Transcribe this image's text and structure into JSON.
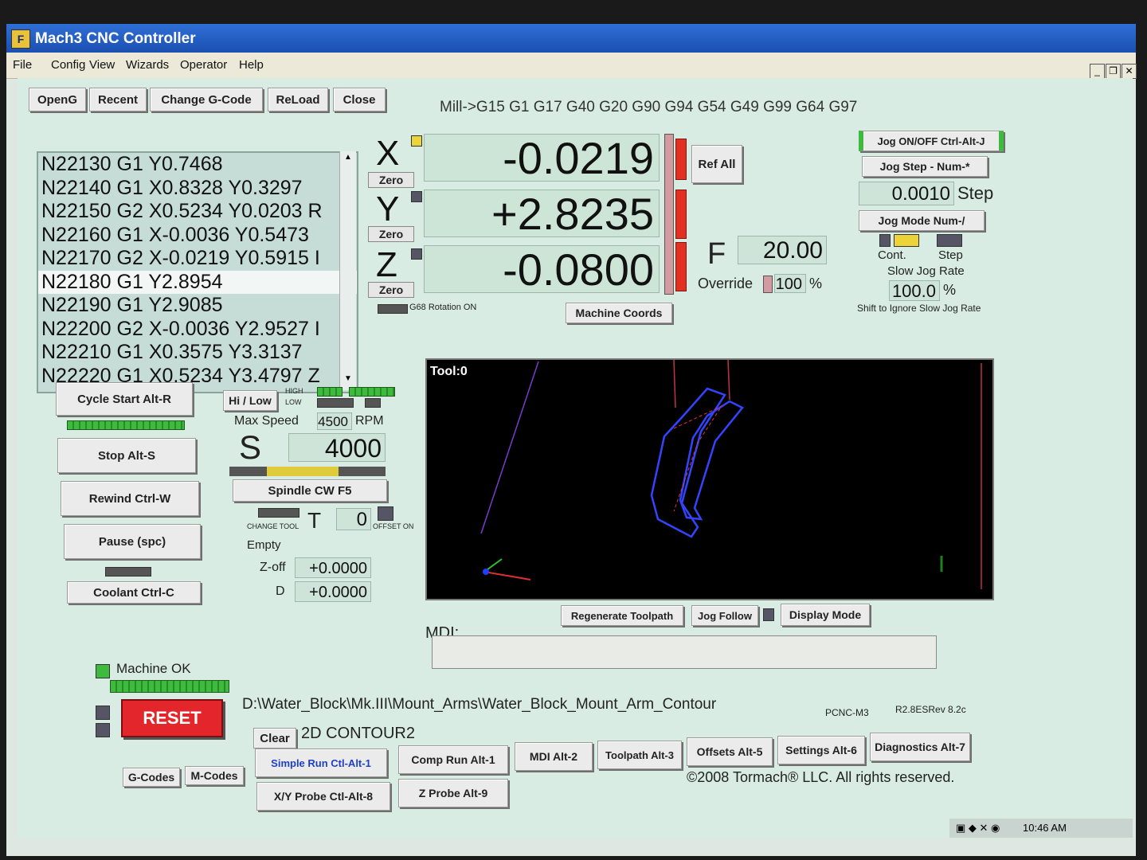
{
  "window": {
    "title": "Mach3 CNC Controller",
    "app_icon": "app-logo-icon"
  },
  "menu": [
    "File",
    "Config",
    "View",
    "Wizards",
    "Operator",
    "Help"
  ],
  "window_controls": {
    "minimize": "_",
    "restore": "❐",
    "close": "✕"
  },
  "file_buttons": [
    "OpenG",
    "Recent",
    "Change G-Code",
    "ReLoad",
    "Close"
  ],
  "modal_line": "Mill->G15  G1 G17 G40 G20 G90 G94 G54 G49 G99 G64 G97",
  "gcode_lines": [
    "N22130 G1 Y0.7468",
    "N22140 G1 X0.8328 Y0.3297",
    "N22150 G2 X0.5234 Y0.0203 R",
    "N22160 G1 X-0.0036 Y0.5473",
    "N22170 G2 X-0.0219 Y0.5915 I",
    "N22180 G1 Y2.8954",
    "N22190 G1 Y2.9085",
    "N22200 G2 X-0.0036 Y2.9527 I",
    "N22210 G1 X0.3575 Y3.3137",
    "N22220 G1 X0.5234 Y3.4797 Z"
  ],
  "dro": {
    "x": {
      "axis": "X",
      "value": "-0.0219",
      "zero_label": "Zero"
    },
    "y": {
      "axis": "Y",
      "value": "+2.8235",
      "zero_label": "Zero"
    },
    "z": {
      "axis": "Z",
      "value": "-0.0800",
      "zero_label": "Zero"
    },
    "g68_label": "G68 Rotation ON",
    "machine_coords": "Machine Coords",
    "ref_all": "Ref All"
  },
  "feed": {
    "label": "F",
    "value": "20.00",
    "override_label": "Override",
    "override_value": "100",
    "percent": "%"
  },
  "jog": {
    "onoff": "Jog ON/OFF Ctrl-Alt-J",
    "step_button": "Jog Step - Num-*",
    "step_value": "0.0010",
    "step_label": "Step",
    "mode_button": "Jog Mode Num-/",
    "cont": "Cont.",
    "step": "Step",
    "slow_rate_label": "Slow Jog Rate",
    "slow_rate_value": "100.0",
    "percent": "%",
    "shift_note": "Shift to Ignore Slow Jog Rate"
  },
  "controls": {
    "cycle_start": "Cycle Start Alt-R",
    "stop": "Stop Alt-S",
    "rewind": "Rewind Ctrl-W",
    "pause": "Pause (spc)",
    "coolant": "Coolant Ctrl-C"
  },
  "spindle": {
    "hilow": "Hi / Low",
    "high": "HIGH",
    "low": "LOW",
    "max_speed_label": "Max Speed",
    "max_speed": "4500",
    "rpm": "RPM",
    "s_label": "S",
    "s_value": "4000",
    "cw_button": "Spindle CW F5"
  },
  "tool": {
    "change_label": "CHANGE TOOL",
    "t_label": "T",
    "t_value": "0",
    "offset_label": "OFFSET ON",
    "empty": "Empty",
    "zoff_label": "Z-off",
    "zoff_value": "+0.0000",
    "d_label": "D",
    "d_value": "+0.0000"
  },
  "toolpath": {
    "tool_label": "Tool:0",
    "regenerate": "Regenerate Toolpath",
    "jog_follow": "Jog Follow",
    "display_mode": "Display Mode"
  },
  "mdi": {
    "label": "MDI:",
    "value": ""
  },
  "status": {
    "machine_ok": "Machine OK",
    "reset": "RESET",
    "file_path": "D:\\Water_Block\\Mk.III\\Mount_Arms\\Water_Block_Mount_Arm_Contour",
    "pcnc": "PCNC-M3",
    "version": "R2.8ESRev 8.2c",
    "clear": "Clear",
    "program_name": "2D CONTOUR2",
    "copyright": "©2008 Tormach® LLC. All rights reserved."
  },
  "bottom_buttons": {
    "gcodes": "G-Codes",
    "mcodes": "M-Codes",
    "simple_run": "Simple Run Ctl-Alt-1",
    "comp_run": "Comp Run Alt-1",
    "mdi": "MDI Alt-2",
    "toolpath": "Toolpath Alt-3",
    "offsets": "Offsets Alt-5",
    "settings": "Settings Alt-6",
    "diagnostics": "Diagnostics Alt-7",
    "xy_probe": "X/Y Probe Ctl-Alt-8",
    "z_probe": "Z Probe Alt-9"
  },
  "taskbar": {
    "time": "10:46 AM"
  }
}
